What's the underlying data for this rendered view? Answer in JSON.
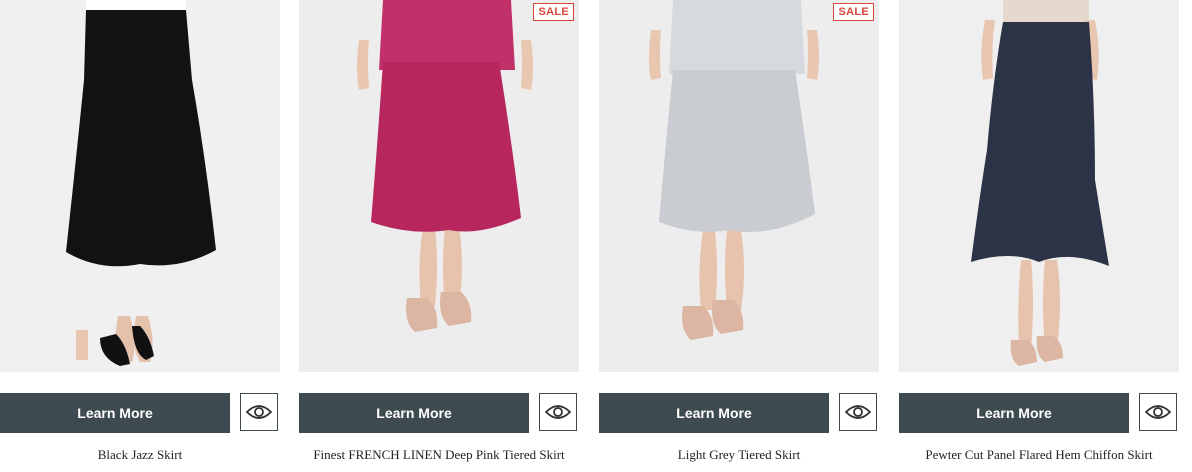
{
  "products": [
    {
      "name": "Black Jazz Skirt",
      "sale": "",
      "button": "Learn More",
      "quickview_icon": "eye-icon",
      "color": "#121212"
    },
    {
      "name": "Finest FRENCH LINEN Deep Pink Tiered Skirt",
      "sale": "SALE",
      "button": "Learn More",
      "quickview_icon": "eye-icon",
      "color": "#b8265e"
    },
    {
      "name": "Light Grey Tiered Skirt",
      "sale": "SALE",
      "button": "Learn More",
      "quickview_icon": "eye-icon",
      "color": "#c9ccd1"
    },
    {
      "name": "Pewter Cut Panel Flared Hem Chiffon Skirt",
      "sale": "",
      "button": "Learn More",
      "quickview_icon": "eye-icon",
      "color": "#2c3346"
    }
  ],
  "colors": {
    "button_bg": "#3d4a4f",
    "sale_red": "#d9463a"
  }
}
